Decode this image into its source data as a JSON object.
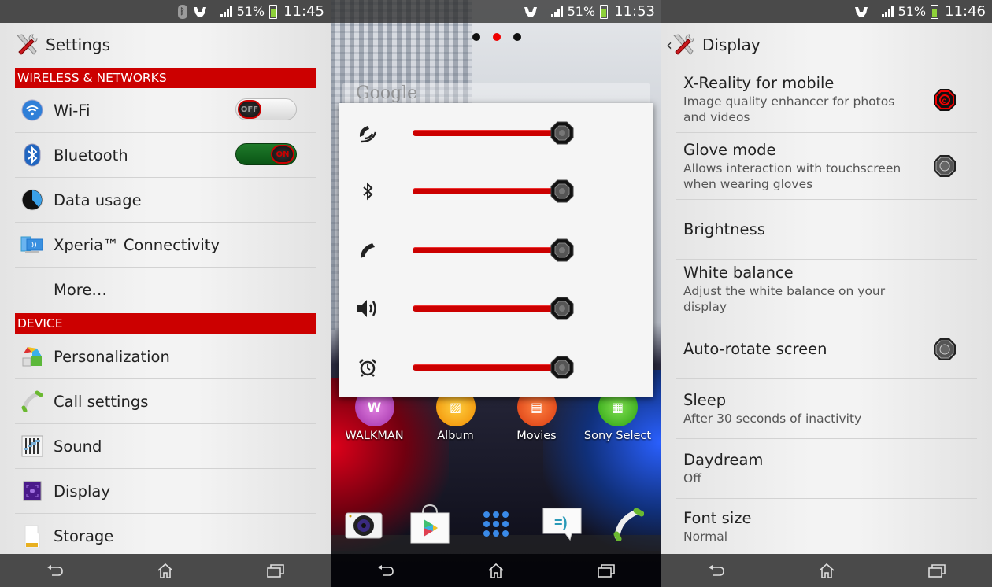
{
  "colors": {
    "accent": "#cc0000",
    "statusbar": "#4a4a4a",
    "toggle_on": "#1f7a2a",
    "battery_fill": "#8ed13a"
  },
  "screens": {
    "settings": {
      "status": {
        "battery": "51%",
        "time": "11:45",
        "icons": [
          "bluetooth-icon",
          "stamina-icon",
          "signal-icon",
          "battery-icon"
        ]
      },
      "title": "Settings",
      "sections": [
        {
          "header": "WIRELESS & NETWORKS",
          "items": [
            {
              "label": "Wi-Fi",
              "icon": "wifi-icon",
              "toggle": "OFF"
            },
            {
              "label": "Bluetooth",
              "icon": "bluetooth-icon",
              "toggle": "ON"
            },
            {
              "label": "Data usage",
              "icon": "data-usage-icon"
            },
            {
              "label": "Xperia™ Connectivity",
              "icon": "xperia-connectivity-icon"
            },
            {
              "label": "More…"
            }
          ]
        },
        {
          "header": "DEVICE",
          "items": [
            {
              "label": "Personalization",
              "icon": "personalization-icon"
            },
            {
              "label": "Call settings",
              "icon": "phone-icon"
            },
            {
              "label": "Sound",
              "icon": "equalizer-icon"
            },
            {
              "label": "Display",
              "icon": "display-icon"
            },
            {
              "label": "Storage",
              "icon": "sd-card-icon"
            }
          ]
        }
      ]
    },
    "volume": {
      "status": {
        "battery": "51%",
        "time": "11:53"
      },
      "page_dots": {
        "count": 3,
        "active": 2
      },
      "search_bar": "Google",
      "sliders": [
        {
          "name": "in-call",
          "icon": "call-volume-icon",
          "value": 1.0
        },
        {
          "name": "bluetooth",
          "icon": "bluetooth-icon",
          "value": 1.0
        },
        {
          "name": "ringtone",
          "icon": "phone-icon",
          "value": 1.0
        },
        {
          "name": "media",
          "icon": "speaker-icon",
          "value": 1.0
        },
        {
          "name": "alarm",
          "icon": "alarm-icon",
          "value": 1.0
        }
      ],
      "apps": [
        {
          "label": "WALKMAN",
          "color": "#b03cb8",
          "icon": "walkman-icon"
        },
        {
          "label": "Album",
          "color": "#f59a0f",
          "icon": "album-icon"
        },
        {
          "label": "Movies",
          "color": "#e8531a",
          "icon": "movies-icon"
        },
        {
          "label": "Sony Select",
          "color": "#3cb81a",
          "icon": "sony-select-icon"
        }
      ],
      "dock": [
        "camera-icon",
        "play-store-icon",
        "app-drawer-icon",
        "messaging-icon",
        "phone-icon"
      ]
    },
    "display": {
      "status": {
        "battery": "51%",
        "time": "11:46"
      },
      "title": "Display",
      "items": [
        {
          "title": "X-Reality for mobile",
          "summary": "Image quality enhancer for photos and videos",
          "checked": true
        },
        {
          "title": "Glove mode",
          "summary": "Allows interaction with touchscreen when wearing gloves",
          "checked": false
        },
        {
          "title": "Brightness",
          "summary": ""
        },
        {
          "title": "White balance",
          "summary": "Adjust the white balance on your display"
        },
        {
          "title": "Auto-rotate screen",
          "summary": "",
          "checked": false
        },
        {
          "title": "Sleep",
          "summary": "After 30 seconds of inactivity"
        },
        {
          "title": "Daydream",
          "summary": "Off"
        },
        {
          "title": "Font size",
          "summary": "Normal"
        }
      ]
    }
  }
}
